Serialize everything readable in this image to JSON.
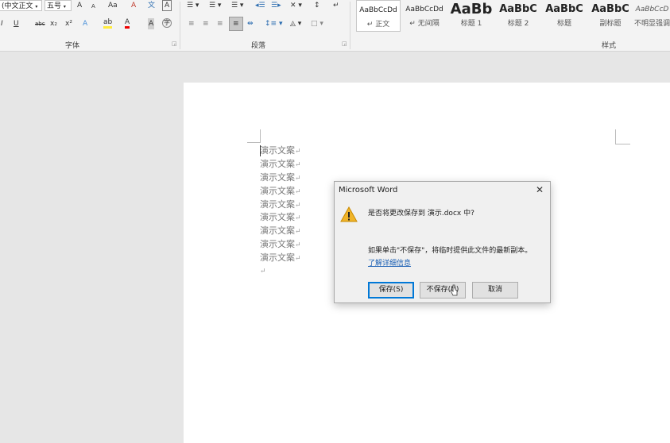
{
  "ribbon": {
    "font_group": {
      "label": "字体",
      "font_name": "(中文正文",
      "font_size": "五号",
      "grow": "A",
      "shrink": "A",
      "change_case": "Aa",
      "clear_format": "A",
      "phonetic": "文",
      "char_border": "A",
      "italic": "I",
      "underline": "U",
      "strike": "abc",
      "subscript": "x₂",
      "superscript": "x²",
      "text_effect": "A",
      "highlight": "ab",
      "font_color": "A",
      "char_shading": "A",
      "enclose": "字"
    },
    "paragraph_group": {
      "label": "段落"
    },
    "styles_group": {
      "label": "样式",
      "items": [
        {
          "preview": "AaBbCcDd",
          "name": "↵ 正文"
        },
        {
          "preview": "AaBbCcDd",
          "name": "↵ 无间隔"
        },
        {
          "preview": "AaBb",
          "name": "标题 1"
        },
        {
          "preview": "AaBbC",
          "name": "标题 2"
        },
        {
          "preview": "AaBbC",
          "name": "标题"
        },
        {
          "preview": "AaBbC",
          "name": "副标题"
        },
        {
          "preview": "AaBbCcD",
          "name": "不明显强调"
        }
      ]
    }
  },
  "document": {
    "lines": [
      "演示文案",
      "演示文案",
      "演示文案",
      "演示文案",
      "演示文案",
      "演示文案",
      "演示文案",
      "演示文案",
      "演示文案",
      ""
    ],
    "paragraph_mark": "↵"
  },
  "dialog": {
    "title": "Microsoft Word",
    "close": "✕",
    "question": "是否将更改保存到 演示.docx 中?",
    "info": "如果单击\"不保存\"，将临时提供此文件的最新副本。",
    "link": "了解详细信息",
    "buttons": {
      "save": "保存(S)",
      "dont_save": "不保存(N)",
      "cancel": "取消"
    }
  },
  "colors": {
    "accent": "#0078d7",
    "link": "#1a5fb4",
    "warning": "#f0b429"
  }
}
